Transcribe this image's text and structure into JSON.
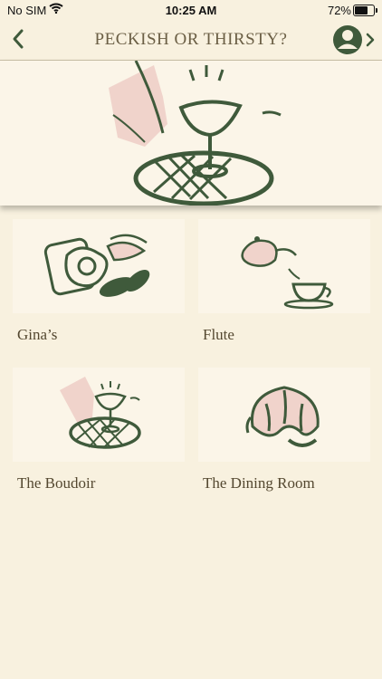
{
  "status_bar": {
    "carrier": "No SIM",
    "time": "10:25 AM",
    "battery": "72%"
  },
  "nav": {
    "title": "PECKISH OR THIRSTY?"
  },
  "colors": {
    "ink": "#3f5a3b",
    "pink": "#f0d3cb",
    "background": "#f8f1df",
    "card": "#fbf5e8"
  },
  "venues": [
    {
      "name": "Gina’s",
      "icon": "breakfast-plate-icon"
    },
    {
      "name": "Flute",
      "icon": "teapot-teacup-icon"
    },
    {
      "name": "The Boudoir",
      "icon": "cocktail-glass-icon"
    },
    {
      "name": "The Dining Room",
      "icon": "croissant-icon"
    }
  ]
}
